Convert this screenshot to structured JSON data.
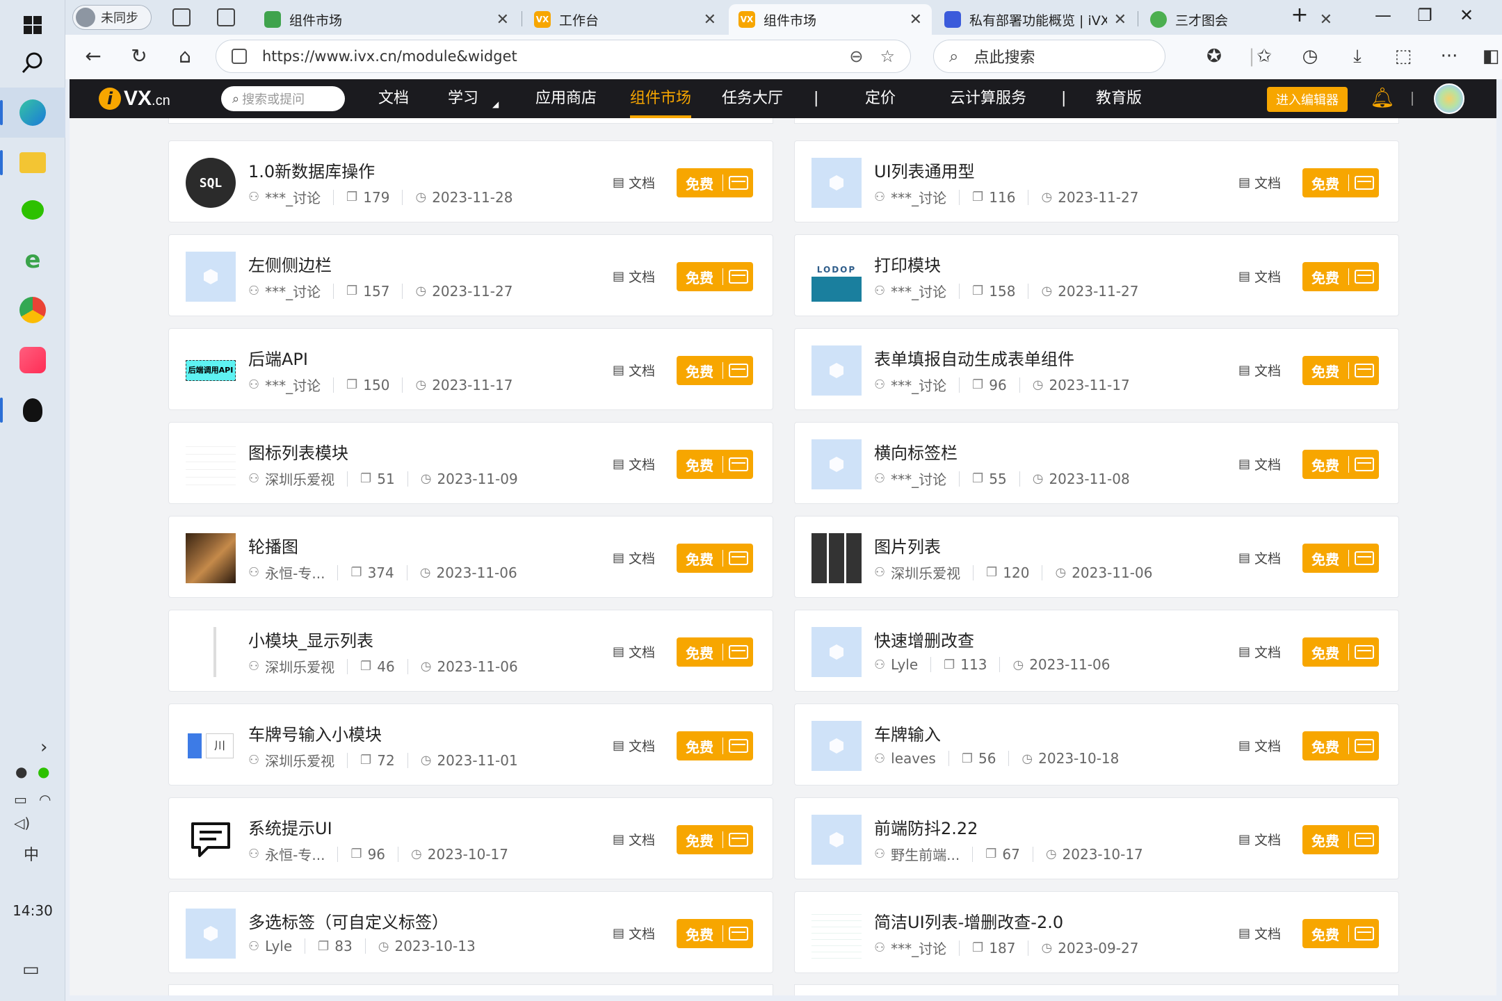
{
  "taskbar": {
    "time": "14:30",
    "ime": "中",
    "expand": "›"
  },
  "browser": {
    "profile_label": "未同步",
    "tabs": [
      {
        "label": "组件市场",
        "color": "#3fa34d",
        "fav": ""
      },
      {
        "label": "工作台",
        "color": "#f7a600",
        "fav": "VX"
      },
      {
        "label": "组件市场",
        "color": "#f7a600",
        "fav": "VX"
      },
      {
        "label": "私有部署功能概览 | iVX文",
        "color": "#3b5bdb",
        "fav": ""
      },
      {
        "label": "三才图会",
        "color": "#4caf50",
        "fav": ""
      }
    ],
    "url": "https://www.ivx.cn/module&widget",
    "search_placeholder": "点此搜索"
  },
  "site": {
    "logo": "VX",
    "logo_suffix": ".cn",
    "search_placeholder": "搜索或提问",
    "menu": {
      "docs": "文档",
      "learn": "学习",
      "store": "应用商店",
      "market": "组件市场",
      "tasks": "任务大厅",
      "sep1": "|",
      "pricing": "定价",
      "cloud": "云计算服务",
      "sep2": "|",
      "edu": "教育版"
    },
    "editor_button": "进入编辑器"
  },
  "cards": [
    {
      "title": "1.0新数据库操作",
      "author": "***_讨论",
      "count": "179",
      "date": "2023-11-28",
      "thumb": "sql",
      "thumb_text": "SQL"
    },
    {
      "title": "UI列表通用型",
      "author": "***_讨论",
      "count": "116",
      "date": "2023-11-27",
      "thumb": "default",
      "thumb_text": ""
    },
    {
      "title": "左侧侧边栏",
      "author": "***_讨论",
      "count": "157",
      "date": "2023-11-27",
      "thumb": "default",
      "thumb_text": ""
    },
    {
      "title": "打印模块",
      "author": "***_讨论",
      "count": "158",
      "date": "2023-11-27",
      "thumb": "lodop",
      "thumb_text": "LODOP"
    },
    {
      "title": "后端API",
      "author": "***_讨论",
      "count": "150",
      "date": "2023-11-17",
      "thumb": "api",
      "thumb_text": "后端调用API"
    },
    {
      "title": "表单填报自动生成表单组件",
      "author": "***_讨论",
      "count": "96",
      "date": "2023-11-17",
      "thumb": "default",
      "thumb_text": ""
    },
    {
      "title": "图标列表模块",
      "author": "深圳乐爱视",
      "count": "51",
      "date": "2023-11-09",
      "thumb": "lines",
      "thumb_text": ""
    },
    {
      "title": "横向标签栏",
      "author": "***_讨论",
      "count": "55",
      "date": "2023-11-08",
      "thumb": "default",
      "thumb_text": ""
    },
    {
      "title": "轮播图",
      "author": "永恒-专...",
      "count": "374",
      "date": "2023-11-06",
      "thumb": "photo",
      "thumb_text": ""
    },
    {
      "title": "图片列表",
      "author": "深圳乐爱视",
      "count": "120",
      "date": "2023-11-06",
      "thumb": "grid",
      "thumb_text": ""
    },
    {
      "title": "小模块_显示列表",
      "author": "深圳乐爱视",
      "count": "46",
      "date": "2023-11-06",
      "thumb": "dotted",
      "thumb_text": ""
    },
    {
      "title": "快速增删改查",
      "author": "Lyle",
      "count": "113",
      "date": "2023-11-06",
      "thumb": "default",
      "thumb_text": ""
    },
    {
      "title": "车牌号输入小模块",
      "author": "深圳乐爱视",
      "count": "72",
      "date": "2023-11-01",
      "thumb": "plate",
      "thumb_text": "川"
    },
    {
      "title": "车牌输入",
      "author": "leaves",
      "count": "56",
      "date": "2023-10-18",
      "thumb": "default",
      "thumb_text": ""
    },
    {
      "title": "系统提示UI",
      "author": "永恒-专...",
      "count": "96",
      "date": "2023-10-17",
      "thumb": "msg",
      "thumb_text": ""
    },
    {
      "title": "前端防抖2.22",
      "author": "野生前端...",
      "count": "67",
      "date": "2023-10-17",
      "thumb": "default",
      "thumb_text": ""
    },
    {
      "title": "多选标签（可自定义标签）",
      "author": "Lyle",
      "count": "83",
      "date": "2023-10-13",
      "thumb": "default",
      "thumb_text": ""
    },
    {
      "title": "简洁UI列表-增删改查-2.0",
      "author": "***_讨论",
      "count": "187",
      "date": "2023-09-27",
      "thumb": "table",
      "thumb_text": ""
    }
  ],
  "card_labels": {
    "doc": "文档",
    "free": "免费"
  },
  "icons": {
    "user": "user-icon",
    "copy": "copy-icon",
    "clock": "clock-icon",
    "doc": "document-icon",
    "accent": "#f7a600"
  }
}
